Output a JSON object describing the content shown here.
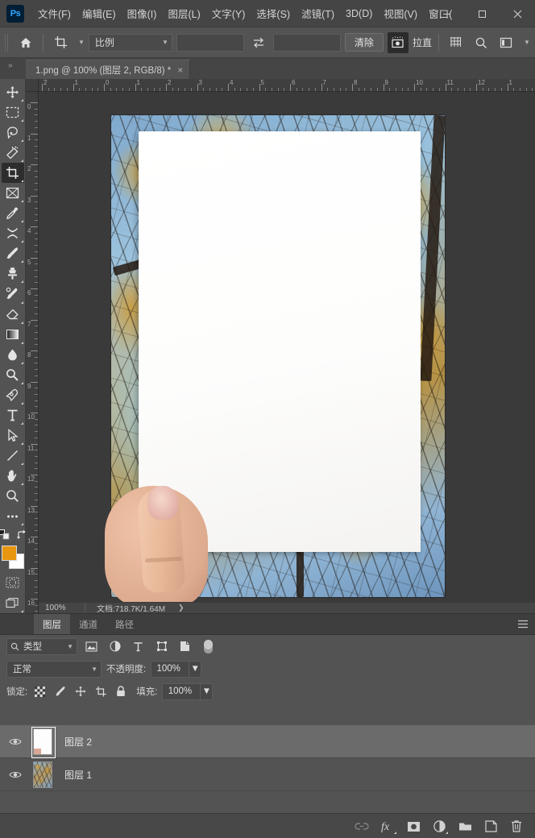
{
  "app": {
    "logo": "Ps",
    "menus": [
      {
        "label": "文件(F)",
        "name": "menu-file"
      },
      {
        "label": "编辑(E)",
        "name": "menu-edit"
      },
      {
        "label": "图像(I)",
        "name": "menu-image"
      },
      {
        "label": "图层(L)",
        "name": "menu-layer"
      },
      {
        "label": "文字(Y)",
        "name": "menu-type"
      },
      {
        "label": "选择(S)",
        "name": "menu-select"
      },
      {
        "label": "滤镜(T)",
        "name": "menu-filter"
      },
      {
        "label": "3D(D)",
        "name": "menu-3d"
      },
      {
        "label": "视图(V)",
        "name": "menu-view"
      },
      {
        "label": "窗口(",
        "name": "menu-window"
      }
    ],
    "window_controls": {
      "minimize": "minimize-button",
      "maximize": "maximize-button",
      "close": "close-button"
    }
  },
  "options_bar": {
    "home_icon": "home-icon",
    "tool_preset_icon": "crop-tool-icon",
    "ratio_label": "比例",
    "width_value": "",
    "width_placeholder": "",
    "swap_icon": "swap-arrows-icon",
    "height_value": "",
    "height_placeholder": "",
    "clear_label": "清除",
    "content_aware_icon": "content-aware-icon",
    "straighten_label": "拉直",
    "overlay_icon": "grid-overlay-icon",
    "settings_icon": "search-icon",
    "toggle_panel_icon": "panel-toggle-icon"
  },
  "document_tab": {
    "title": "1.png @ 100% (图层 2, RGB/8) *",
    "close_icon": "close-icon",
    "expand_icon": "double-chevron-icon"
  },
  "toolbar": {
    "tools": [
      {
        "name": "move-tool",
        "icon": "move-icon",
        "selected": false
      },
      {
        "name": "marquee-tool",
        "icon": "rectangular-marquee-icon",
        "selected": false
      },
      {
        "name": "lasso-tool",
        "icon": "lasso-icon",
        "selected": false
      },
      {
        "name": "magic-wand-tool",
        "icon": "magic-wand-icon",
        "selected": false
      },
      {
        "name": "crop-tool",
        "icon": "crop-icon",
        "selected": true
      },
      {
        "name": "frame-tool",
        "icon": "frame-icon",
        "selected": false
      },
      {
        "name": "eyedropper-tool",
        "icon": "eyedropper-icon",
        "selected": false
      },
      {
        "name": "healing-brush-tool",
        "icon": "healing-brush-icon",
        "selected": false
      },
      {
        "name": "brush-tool",
        "icon": "brush-icon",
        "selected": false
      },
      {
        "name": "clone-stamp-tool",
        "icon": "clone-stamp-icon",
        "selected": false
      },
      {
        "name": "history-brush-tool",
        "icon": "history-brush-icon",
        "selected": false
      },
      {
        "name": "eraser-tool",
        "icon": "eraser-icon",
        "selected": false
      },
      {
        "name": "gradient-tool",
        "icon": "gradient-icon",
        "selected": false
      },
      {
        "name": "blur-tool",
        "icon": "blur-drop-icon",
        "selected": false
      },
      {
        "name": "dodge-tool",
        "icon": "dodge-icon",
        "selected": false
      },
      {
        "name": "pen-tool",
        "icon": "pen-icon",
        "selected": false
      },
      {
        "name": "type-tool",
        "icon": "type-T-icon",
        "selected": false
      },
      {
        "name": "path-selection-tool",
        "icon": "path-arrow-icon",
        "selected": false
      },
      {
        "name": "shape-tool",
        "icon": "line-shape-icon",
        "selected": false
      },
      {
        "name": "hand-tool",
        "icon": "hand-icon",
        "selected": false
      },
      {
        "name": "zoom-tool",
        "icon": "magnifier-icon",
        "selected": false
      },
      {
        "name": "edit-toolbar",
        "icon": "ellipsis-icon",
        "selected": false
      }
    ],
    "default_colors_icon": "default-colors-icon",
    "swap_colors_icon": "swap-colors-icon",
    "foreground_color": "#E8960F",
    "background_color": "#FFFFFF",
    "quick_mask_icon": "quick-mask-icon",
    "screen_mode_icon": "screen-mode-icon"
  },
  "rulers": {
    "horizontal": [
      "2",
      "1",
      "0",
      "1",
      "2",
      "3",
      "4",
      "5",
      "6",
      "7",
      "8",
      "9",
      "10",
      "11",
      "12",
      "1"
    ],
    "vertical": [
      "0",
      "1",
      "2",
      "3",
      "4",
      "5",
      "6",
      "7",
      "8",
      "9",
      "10",
      "11",
      "12",
      "13",
      "14",
      "15",
      "16"
    ]
  },
  "status_bar": {
    "zoom": "100%",
    "doc_info": "文档:718.7K/1.64M",
    "arrow_icon": "chevron-right-icon"
  },
  "panel": {
    "tabs": [
      {
        "label": "图层",
        "name": "tab-layers",
        "active": true
      },
      {
        "label": "通道",
        "name": "tab-channels",
        "active": false
      },
      {
        "label": "路径",
        "name": "tab-paths",
        "active": false
      }
    ],
    "menu_icon": "panel-menu-icon",
    "filter": {
      "search_icon": "search-icon",
      "kind_label": "类型",
      "caret_icon": "chevron-down-icon",
      "icons": [
        {
          "name": "filter-pixel-icon",
          "icon": "image-icon"
        },
        {
          "name": "filter-adjustment-icon",
          "icon": "half-circle-icon"
        },
        {
          "name": "filter-type-icon",
          "icon": "type-T-icon"
        },
        {
          "name": "filter-shape-icon",
          "icon": "shape-icon"
        },
        {
          "name": "filter-smart-object-icon",
          "icon": "smart-object-icon"
        }
      ],
      "toggle_name": "filter-toggle-switch"
    },
    "blend": {
      "mode": "正常",
      "opacity_label": "不透明度:",
      "opacity_value": "100%"
    },
    "lock": {
      "label": "锁定:",
      "icons": [
        {
          "name": "lock-transparent-pixels-icon",
          "icon": "checkerboard-icon"
        },
        {
          "name": "lock-image-pixels-icon",
          "icon": "brush-icon"
        },
        {
          "name": "lock-position-icon",
          "icon": "move-icon"
        },
        {
          "name": "lock-nesting-icon",
          "icon": "artboard-icon"
        },
        {
          "name": "lock-all-icon",
          "icon": "padlock-icon"
        }
      ],
      "fill_label": "填充:",
      "fill_value": "100%"
    },
    "layers": [
      {
        "name": "图层 2",
        "visible": true,
        "selected": true,
        "thumb": "white-paper",
        "eye_icon": "eye-icon"
      },
      {
        "name": "图层 1",
        "visible": true,
        "selected": false,
        "thumb": "tree-photo",
        "eye_icon": "eye-icon"
      }
    ],
    "bottom_buttons": [
      {
        "name": "link-layers-button",
        "icon": "link-icon",
        "disabled": true
      },
      {
        "name": "layer-style-button",
        "icon": "fx-icon",
        "disabled": false
      },
      {
        "name": "layer-mask-button",
        "icon": "mask-icon",
        "disabled": false
      },
      {
        "name": "adjustment-layer-button",
        "icon": "half-circle-icon",
        "disabled": false
      },
      {
        "name": "new-group-button",
        "icon": "folder-icon",
        "disabled": false
      },
      {
        "name": "new-layer-button",
        "icon": "new-layer-icon",
        "disabled": false
      },
      {
        "name": "delete-layer-button",
        "icon": "trash-icon",
        "disabled": false
      }
    ]
  },
  "canvas": {
    "image_description": "autumn-trees-sky-with-white-paper-held-by-hand"
  }
}
